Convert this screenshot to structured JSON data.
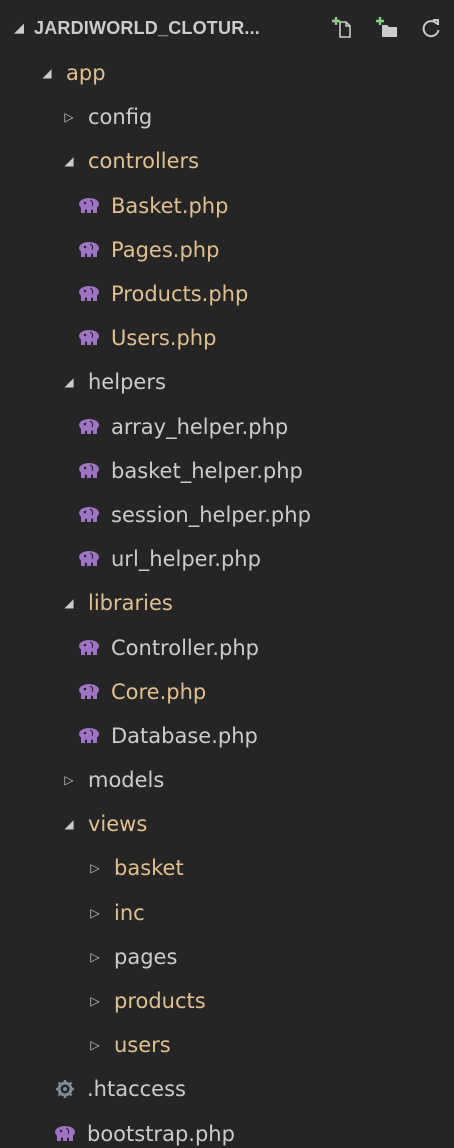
{
  "header": {
    "title": "JARDIWORLD_CLOTUR...",
    "actions": [
      {
        "name": "new-file",
        "icon": "new-file-icon"
      },
      {
        "name": "new-folder",
        "icon": "new-folder-icon"
      },
      {
        "name": "refresh",
        "icon": "refresh-icon"
      }
    ]
  },
  "colors": {
    "background": "#252526",
    "modified": "#e2c08d",
    "normal": "#cccccc",
    "php_icon": "#a074c4",
    "gear_icon": "#7d8c99"
  },
  "tree": [
    {
      "label": "app",
      "type": "folder",
      "expanded": true,
      "depth": 0,
      "color": "modified"
    },
    {
      "label": "config",
      "type": "folder",
      "expanded": false,
      "depth": 1,
      "color": "normal"
    },
    {
      "label": "controllers",
      "type": "folder",
      "expanded": true,
      "depth": 1,
      "color": "modified"
    },
    {
      "label": "Basket.php",
      "type": "php",
      "depth": 2,
      "color": "modified"
    },
    {
      "label": "Pages.php",
      "type": "php",
      "depth": 2,
      "color": "modified"
    },
    {
      "label": "Products.php",
      "type": "php",
      "depth": 2,
      "color": "modified"
    },
    {
      "label": "Users.php",
      "type": "php",
      "depth": 2,
      "color": "modified"
    },
    {
      "label": "helpers",
      "type": "folder",
      "expanded": true,
      "depth": 1,
      "color": "normal"
    },
    {
      "label": "array_helper.php",
      "type": "php",
      "depth": 2,
      "color": "normal"
    },
    {
      "label": "basket_helper.php",
      "type": "php",
      "depth": 2,
      "color": "normal"
    },
    {
      "label": "session_helper.php",
      "type": "php",
      "depth": 2,
      "color": "normal"
    },
    {
      "label": "url_helper.php",
      "type": "php",
      "depth": 2,
      "color": "normal"
    },
    {
      "label": "libraries",
      "type": "folder",
      "expanded": true,
      "depth": 1,
      "color": "modified"
    },
    {
      "label": "Controller.php",
      "type": "php",
      "depth": 2,
      "color": "normal"
    },
    {
      "label": "Core.php",
      "type": "php",
      "depth": 2,
      "color": "modified"
    },
    {
      "label": "Database.php",
      "type": "php",
      "depth": 2,
      "color": "normal"
    },
    {
      "label": "models",
      "type": "folder",
      "expanded": false,
      "depth": 1,
      "color": "normal"
    },
    {
      "label": "views",
      "type": "folder",
      "expanded": true,
      "depth": 1,
      "color": "modified"
    },
    {
      "label": "basket",
      "type": "folder",
      "expanded": false,
      "depth": 2,
      "color": "modified"
    },
    {
      "label": "inc",
      "type": "folder",
      "expanded": false,
      "depth": 2,
      "color": "modified"
    },
    {
      "label": "pages",
      "type": "folder",
      "expanded": false,
      "depth": 2,
      "color": "normal"
    },
    {
      "label": "products",
      "type": "folder",
      "expanded": false,
      "depth": 2,
      "color": "modified"
    },
    {
      "label": "users",
      "type": "folder",
      "expanded": false,
      "depth": 2,
      "color": "modified"
    },
    {
      "label": ".htaccess",
      "type": "config",
      "depth": 1,
      "color": "normal"
    },
    {
      "label": "bootstrap.php",
      "type": "php",
      "depth": 1,
      "color": "normal"
    }
  ]
}
